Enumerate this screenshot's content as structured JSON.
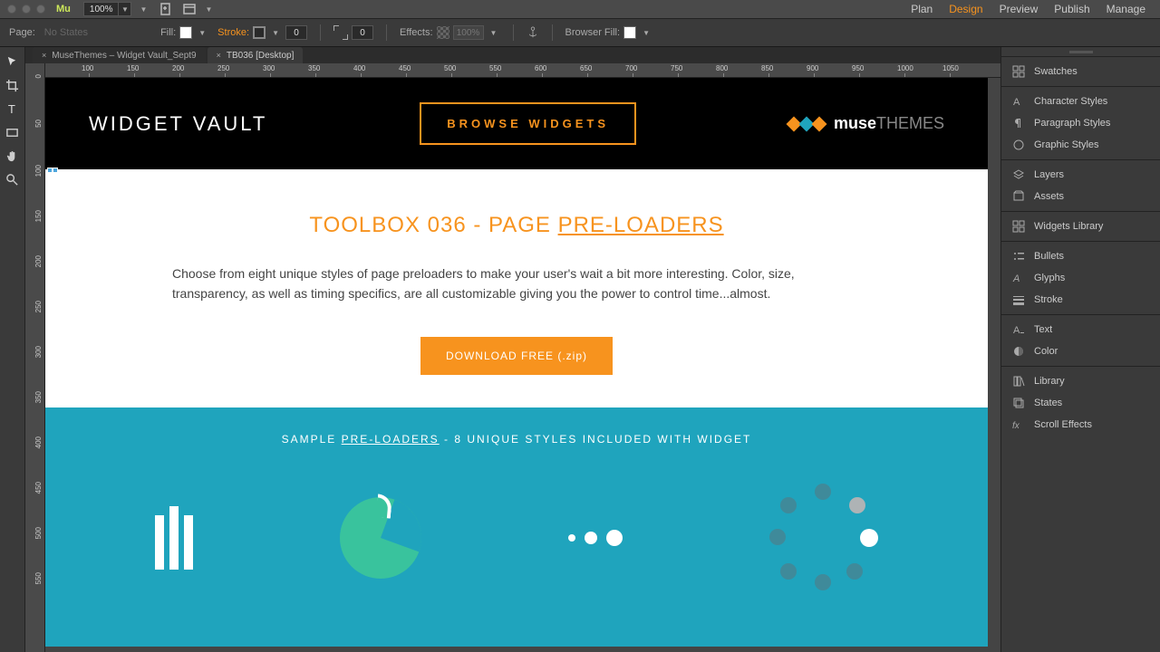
{
  "app": {
    "brand": "Mu",
    "zoom": "100%"
  },
  "menu": {
    "items": [
      "Plan",
      "Design",
      "Preview",
      "Publish",
      "Manage"
    ],
    "active": 1
  },
  "controlbar": {
    "page_label": "Page:",
    "nostates": "No States",
    "fill_label": "Fill:",
    "stroke_label": "Stroke:",
    "stroke_val": "0",
    "corner_val": "0",
    "effects_label": "Effects:",
    "pct": "100%",
    "browserfill_label": "Browser Fill:"
  },
  "tabs": [
    {
      "label": "MuseThemes – Widget Vault_Sept9",
      "active": false
    },
    {
      "label": "TB036 [Desktop]",
      "active": true
    }
  ],
  "ruler_h": [
    100,
    150,
    200,
    250,
    300,
    350,
    400,
    450,
    500,
    550,
    600,
    650,
    700,
    750,
    800,
    850,
    900,
    950,
    1000,
    1050
  ],
  "ruler_v": [
    0,
    50,
    100,
    150,
    200,
    250,
    300,
    350,
    400,
    450,
    500,
    550
  ],
  "page": {
    "header": {
      "brand": "WIDGET VAULT",
      "browse": "BROWSE WIDGETS",
      "logo_a": "muse",
      "logo_b": "THEMES"
    },
    "title_a": "TOOLBOX 036 - PAGE ",
    "title_b": "PRE-LOADERS",
    "body": "Choose from eight unique styles of page preloaders to make your user's wait a bit more interesting. Color, size, transparency, as well as timing specifics, are all customizable giving you the power to control time...almost.",
    "download": "DOWNLOAD FREE (.zip)",
    "teal_sub_a": "SAMPLE ",
    "teal_sub_b": "PRE-LOADERS",
    "teal_sub_c": " - 8 UNIQUE STYLES INCLUDED WITH WIDGET"
  },
  "panels": [
    [
      "Swatches"
    ],
    [
      "Character Styles",
      "Paragraph Styles",
      "Graphic Styles"
    ],
    [
      "Layers",
      "Assets"
    ],
    [
      "Widgets Library"
    ],
    [
      "Bullets",
      "Glyphs",
      "Stroke"
    ],
    [
      "Text",
      "Color"
    ],
    [
      "Library",
      "States",
      "Scroll Effects"
    ]
  ]
}
